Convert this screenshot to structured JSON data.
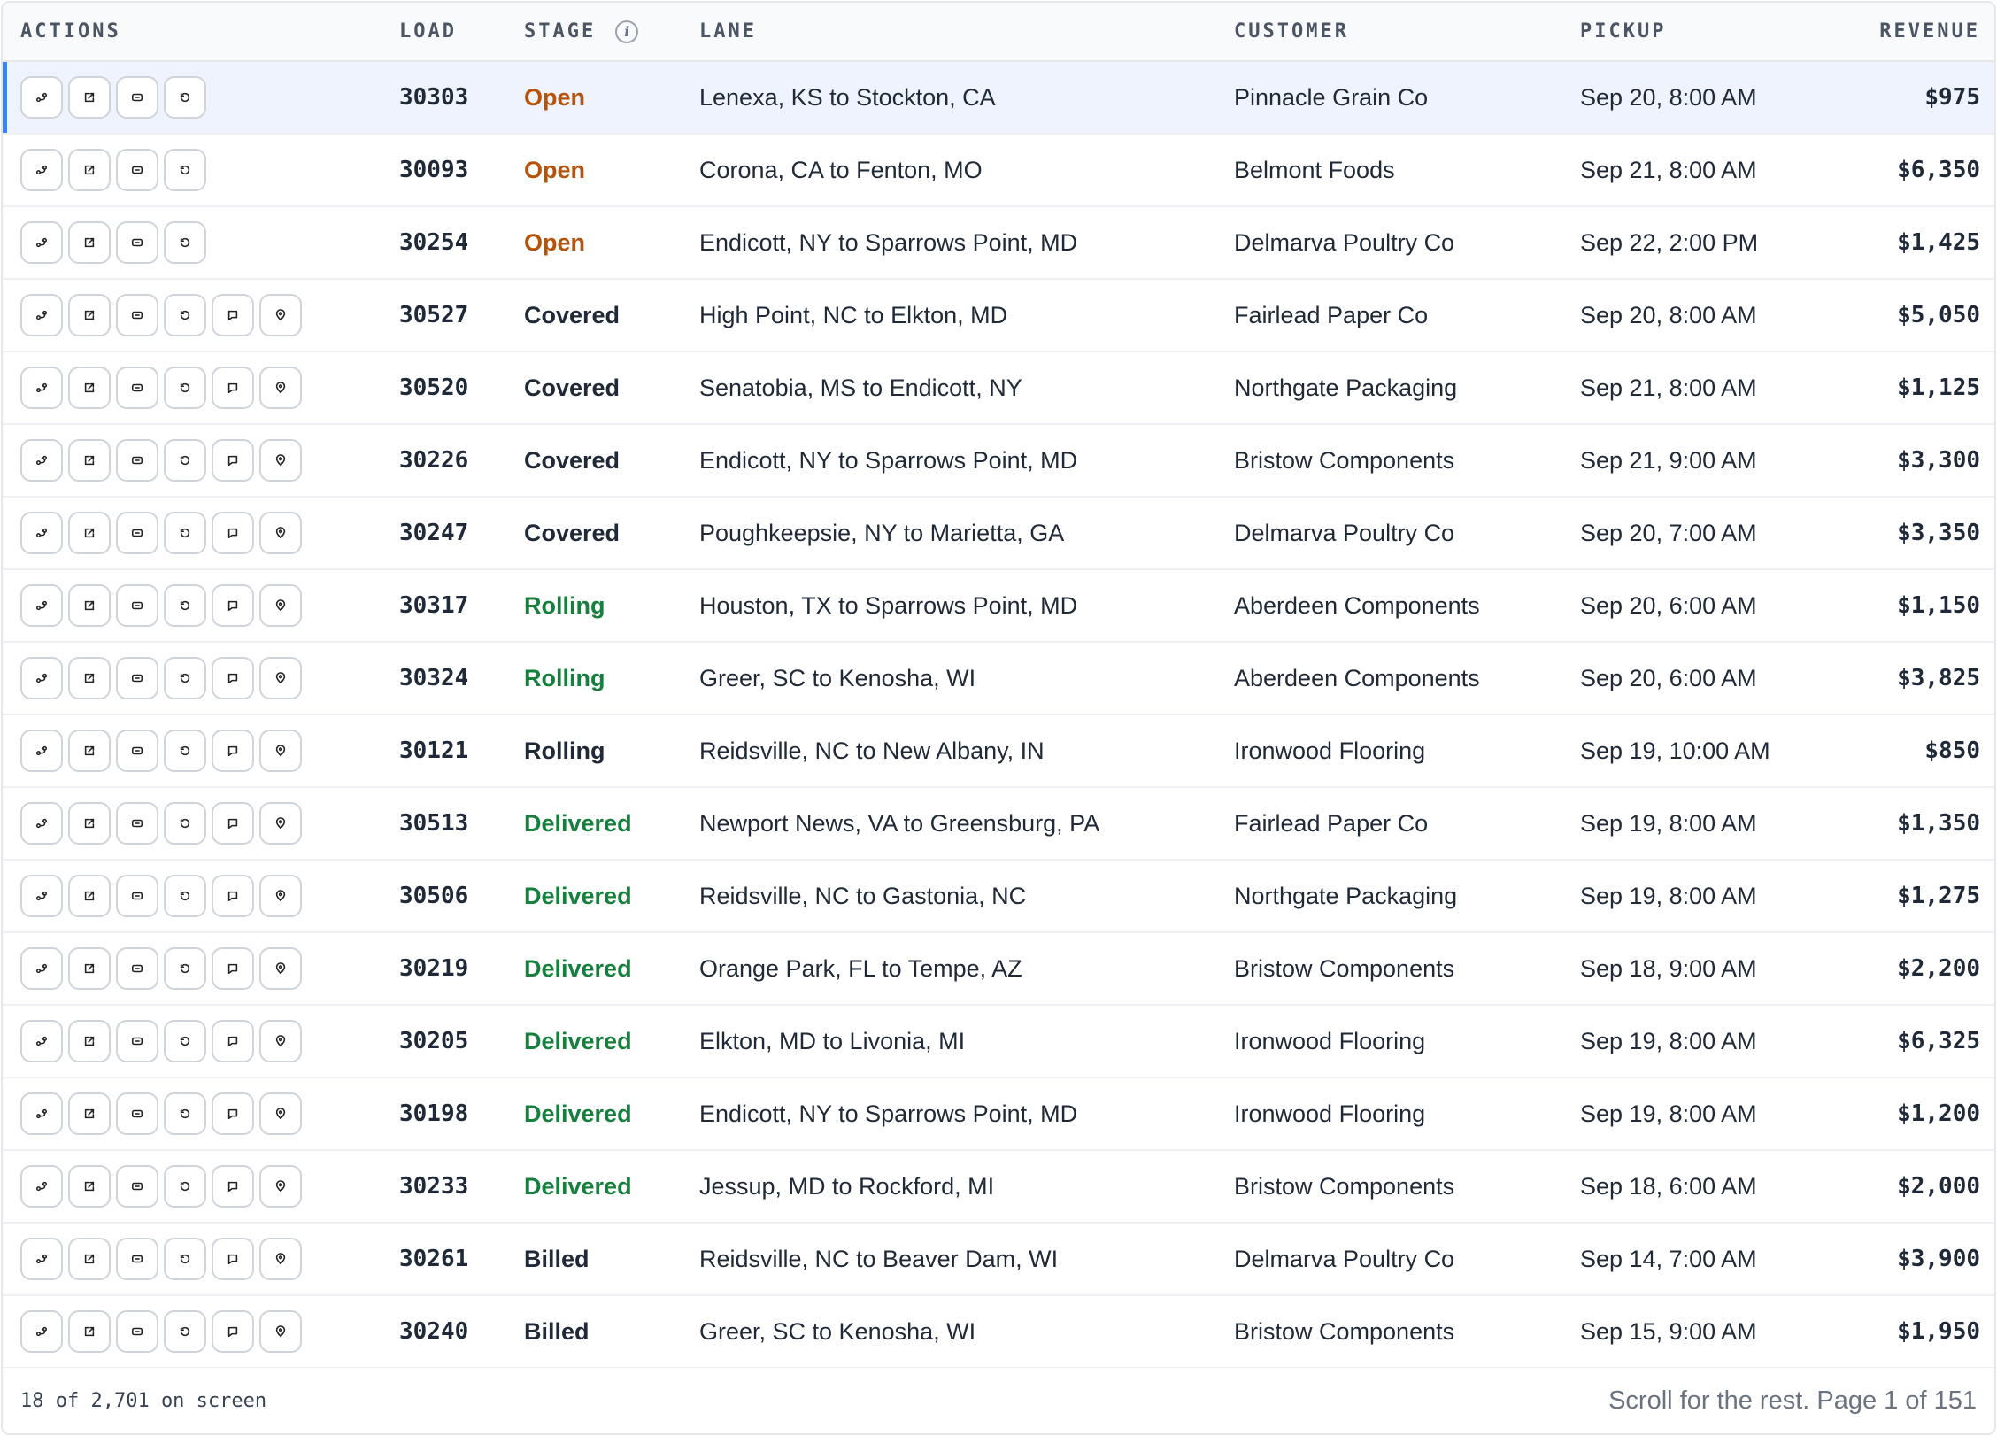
{
  "columns": {
    "actions": "ACTIONS",
    "load": "LOAD",
    "stage": "STAGE",
    "stage_info_icon": "i",
    "lane": "LANE",
    "customer": "CUSTOMER",
    "pickup": "PICKUP",
    "revenue": "REVENUE"
  },
  "colors": {
    "open": "#b45309",
    "green": "#15803d",
    "neutral": "#1f2937",
    "selected_row": "#eef3fe",
    "accent": "#3b82f6"
  },
  "action_icons": [
    "route-icon",
    "external-link-icon",
    "document-icon",
    "history-icon",
    "message-icon",
    "location-pin-icon"
  ],
  "rows": [
    {
      "load": "30303",
      "stage": "Open",
      "stage_style": "open",
      "lane": "Lenexa, KS to Stockton, CA",
      "customer": "Pinnacle Grain Co",
      "pickup": "Sep 20, 8:00 AM",
      "revenue": "$975",
      "actions": 4,
      "selected": true
    },
    {
      "load": "30093",
      "stage": "Open",
      "stage_style": "open",
      "lane": "Corona, CA to Fenton, MO",
      "customer": "Belmont Foods",
      "pickup": "Sep 21, 8:00 AM",
      "revenue": "$6,350",
      "actions": 4
    },
    {
      "load": "30254",
      "stage": "Open",
      "stage_style": "open",
      "lane": "Endicott, NY to Sparrows Point, MD",
      "customer": "Delmarva Poultry Co",
      "pickup": "Sep 22, 2:00 PM",
      "revenue": "$1,425",
      "actions": 4
    },
    {
      "load": "30527",
      "stage": "Covered",
      "stage_style": "covered",
      "lane": "High Point, NC to Elkton, MD",
      "customer": "Fairlead Paper Co",
      "pickup": "Sep 20, 8:00 AM",
      "revenue": "$5,050",
      "actions": 6
    },
    {
      "load": "30520",
      "stage": "Covered",
      "stage_style": "covered",
      "lane": "Senatobia, MS to Endicott, NY",
      "customer": "Northgate Packaging",
      "pickup": "Sep 21, 8:00 AM",
      "revenue": "$1,125",
      "actions": 6
    },
    {
      "load": "30226",
      "stage": "Covered",
      "stage_style": "covered",
      "lane": "Endicott, NY to Sparrows Point, MD",
      "customer": "Bristow Components",
      "pickup": "Sep 21, 9:00 AM",
      "revenue": "$3,300",
      "actions": 6
    },
    {
      "load": "30247",
      "stage": "Covered",
      "stage_style": "covered",
      "lane": "Poughkeepsie, NY to Marietta, GA",
      "customer": "Delmarva Poultry Co",
      "pickup": "Sep 20, 7:00 AM",
      "revenue": "$3,350",
      "actions": 6
    },
    {
      "load": "30317",
      "stage": "Rolling",
      "stage_style": "rolling-green",
      "lane": "Houston, TX to Sparrows Point, MD",
      "customer": "Aberdeen Components",
      "pickup": "Sep 20, 6:00 AM",
      "revenue": "$1,150",
      "actions": 6
    },
    {
      "load": "30324",
      "stage": "Rolling",
      "stage_style": "rolling-green",
      "lane": "Greer, SC to Kenosha, WI",
      "customer": "Aberdeen Components",
      "pickup": "Sep 20, 6:00 AM",
      "revenue": "$3,825",
      "actions": 6
    },
    {
      "load": "30121",
      "stage": "Rolling",
      "stage_style": "rolling-dark",
      "lane": "Reidsville, NC to New Albany, IN",
      "customer": "Ironwood Flooring",
      "pickup": "Sep 19, 10:00 AM",
      "revenue": "$850",
      "actions": 6
    },
    {
      "load": "30513",
      "stage": "Delivered",
      "stage_style": "delivered",
      "lane": "Newport News, VA to Greensburg, PA",
      "customer": "Fairlead Paper Co",
      "pickup": "Sep 19, 8:00 AM",
      "revenue": "$1,350",
      "actions": 6
    },
    {
      "load": "30506",
      "stage": "Delivered",
      "stage_style": "delivered",
      "lane": "Reidsville, NC to Gastonia, NC",
      "customer": "Northgate Packaging",
      "pickup": "Sep 19, 8:00 AM",
      "revenue": "$1,275",
      "actions": 6
    },
    {
      "load": "30219",
      "stage": "Delivered",
      "stage_style": "delivered",
      "lane": "Orange Park, FL to Tempe, AZ",
      "customer": "Bristow Components",
      "pickup": "Sep 18, 9:00 AM",
      "revenue": "$2,200",
      "actions": 6
    },
    {
      "load": "30205",
      "stage": "Delivered",
      "stage_style": "delivered",
      "lane": "Elkton, MD to Livonia, MI",
      "customer": "Ironwood Flooring",
      "pickup": "Sep 19, 8:00 AM",
      "revenue": "$6,325",
      "actions": 6
    },
    {
      "load": "30198",
      "stage": "Delivered",
      "stage_style": "delivered",
      "lane": "Endicott, NY to Sparrows Point, MD",
      "customer": "Ironwood Flooring",
      "pickup": "Sep 19, 8:00 AM",
      "revenue": "$1,200",
      "actions": 6
    },
    {
      "load": "30233",
      "stage": "Delivered",
      "stage_style": "delivered",
      "lane": "Jessup, MD to Rockford, MI",
      "customer": "Bristow Components",
      "pickup": "Sep 18, 6:00 AM",
      "revenue": "$2,000",
      "actions": 6
    },
    {
      "load": "30261",
      "stage": "Billed",
      "stage_style": "billed",
      "lane": "Reidsville, NC to Beaver Dam, WI",
      "customer": "Delmarva Poultry Co",
      "pickup": "Sep 14, 7:00 AM",
      "revenue": "$3,900",
      "actions": 6
    },
    {
      "load": "30240",
      "stage": "Billed",
      "stage_style": "billed",
      "lane": "Greer, SC to Kenosha, WI",
      "customer": "Bristow Components",
      "pickup": "Sep 15, 9:00 AM",
      "revenue": "$1,950",
      "actions": 6
    }
  ],
  "footer": {
    "count": "18 of 2,701 on screen",
    "hint": "Scroll for the rest. Page 1 of 151"
  }
}
